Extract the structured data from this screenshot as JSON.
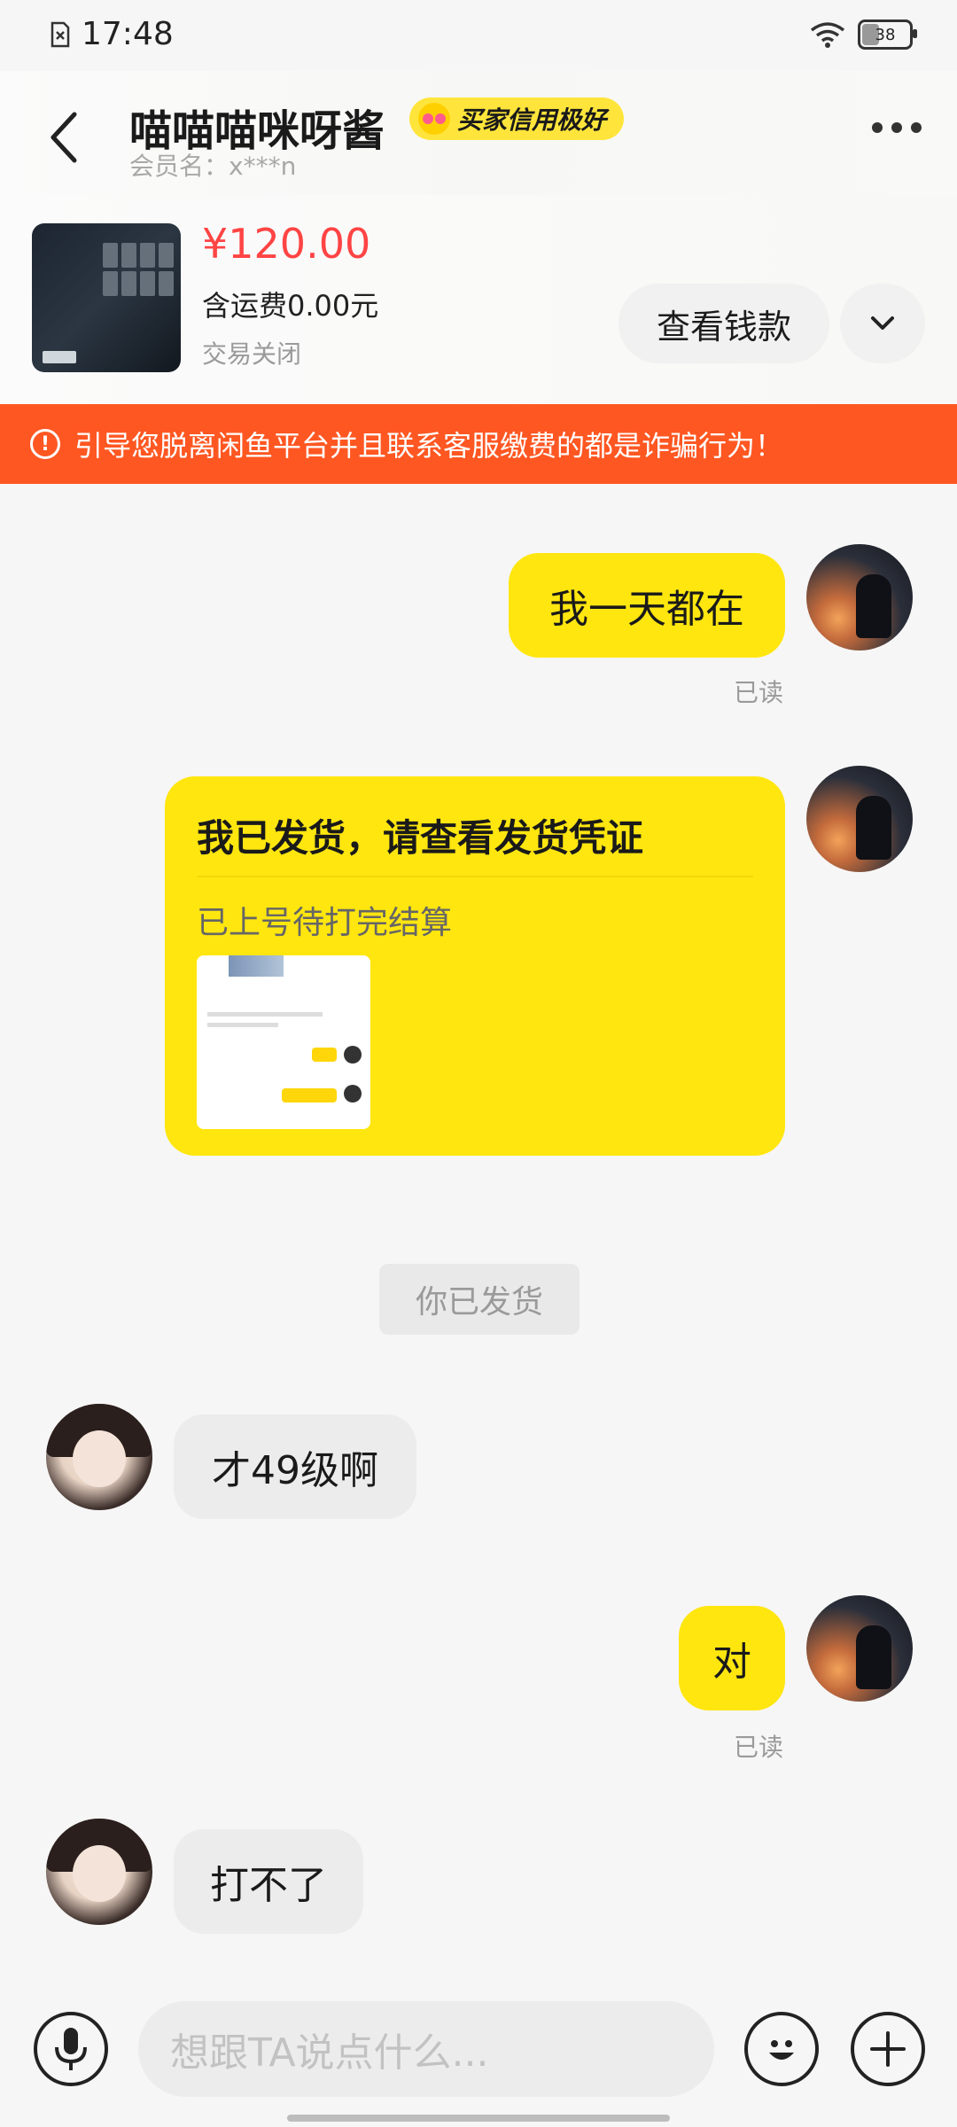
{
  "status_bar": {
    "time": "17:48",
    "battery_level": 38,
    "battery_text": "38"
  },
  "header": {
    "title": "喵喵喵咪呀酱",
    "credit_badge": "买家信用极好",
    "subtitle": "会员名：x***n"
  },
  "product": {
    "price": "¥120.00",
    "shipping": "含运费0.00元",
    "status": "交易关闭",
    "view_payment_button": "查看钱款"
  },
  "warning_banner": "引导您脱离闲鱼平台并且联系客服缴费的都是诈骗行为！",
  "messages": {
    "m1": {
      "text": "我一天都在",
      "read": "已读"
    },
    "card": {
      "title": "我已发货，请查看发货凭证",
      "subtitle": "已上号待打完结算"
    },
    "system": "你已发货",
    "m2": {
      "text": "才49级啊"
    },
    "m3": {
      "text": "对",
      "read": "已读"
    },
    "m4": {
      "text": "打不了"
    }
  },
  "input": {
    "placeholder": "想跟TA说点什么..."
  },
  "colors": {
    "accent_yellow": "#ffe60f",
    "warning_orange": "#ff5722",
    "price_red": "#ff4444"
  }
}
